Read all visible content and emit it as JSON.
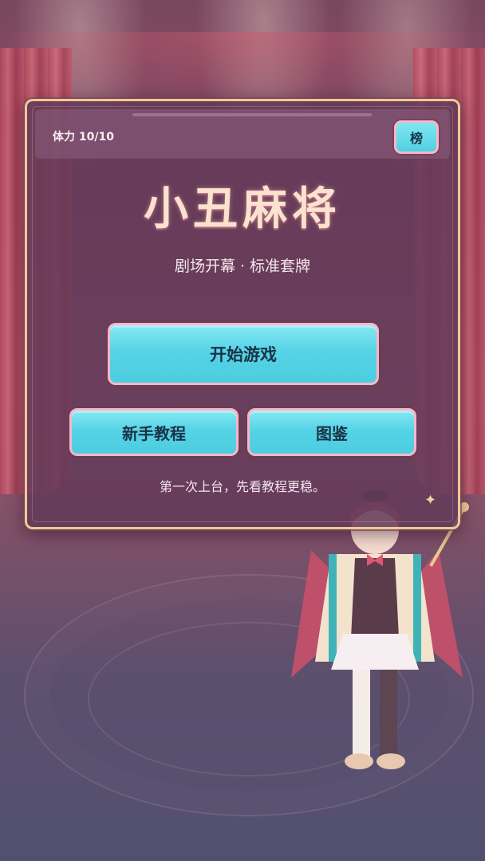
{
  "header": {
    "stamina": "体力 10/10",
    "rank_label": "榜"
  },
  "title": {
    "main": "小丑麻将",
    "subtitle": "剧场开幕 · 标准套牌"
  },
  "menu": {
    "start_label": "开始游戏",
    "tutorial_label": "新手教程",
    "codex_label": "图鉴"
  },
  "hint": "第一次上台，先看教程更稳。",
  "colors": {
    "button_fill": "#56d3e6",
    "button_border": "#f6b7c9",
    "panel_border": "#efc996",
    "title_color": "#fbe2cf"
  },
  "icons": {
    "sparkle": "sparkle-icon",
    "character": "jester-girl-illustration"
  }
}
